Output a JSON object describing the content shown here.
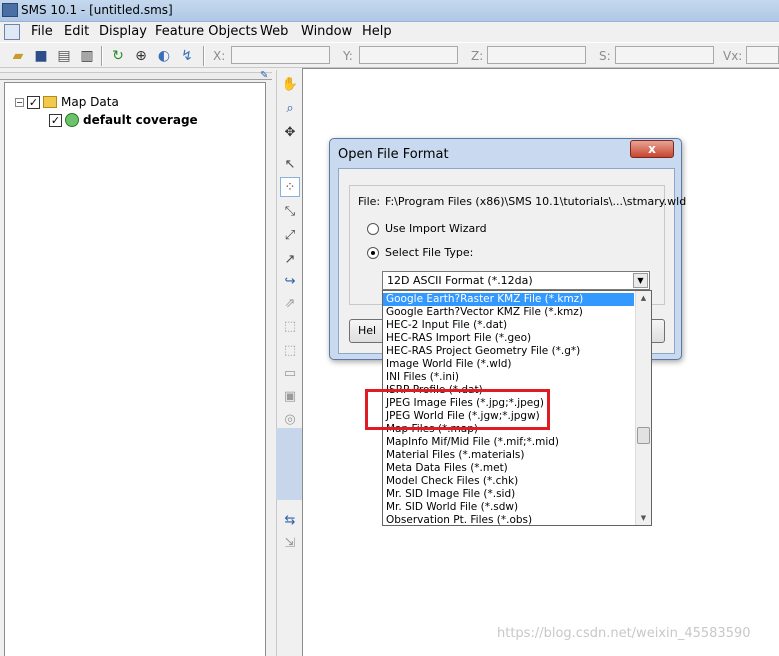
{
  "window": {
    "title": "SMS 10.1 - [untitled.sms]"
  },
  "menu": [
    "File",
    "Edit",
    "Display",
    "Feature Objects",
    "Web",
    "Window",
    "Help"
  ],
  "toolbar": {
    "icons": [
      "open-icon",
      "save-icon",
      "print-icon",
      "delete-icon",
      "refresh-icon",
      "zoom-icon",
      "mapper-icon",
      "gauge-icon"
    ],
    "coord_labels": [
      "X:",
      "Y:",
      "Z:",
      "S:",
      "Vx:"
    ]
  },
  "tree": {
    "root": {
      "label": "Map Data",
      "expander": "−",
      "check": "✓"
    },
    "child": {
      "label": "default coverage",
      "check": "✓"
    }
  },
  "dialog": {
    "title": "Open File Format",
    "close_label": "x",
    "file_label": "File:",
    "file_path": "F:\\Program Files (x86)\\SMS 10.1\\tutorials\\...\\stmary.wld",
    "radio_import": "Use Import Wizard",
    "radio_select": "Select File Type:",
    "selected_radio": "select",
    "help_label": "Hel"
  },
  "combo": {
    "value": "12D ASCII Format (*.12da)"
  },
  "dropdown": {
    "items": [
      "Google Earth?Raster KMZ File (*.kmz)",
      "Google Earth?Vector KMZ File (*.kmz)",
      "HEC-2 Input File (*.dat)",
      "HEC-RAS Import File (*.geo)",
      "HEC-RAS Project Geometry File (*.g*)",
      "Image World File (*.wld)",
      "INI Files (*.ini)",
      "ISRP Profile (*.dat)",
      "JPEG Image Files (*.jpg;*.jpeg)",
      "JPEG World File (*.jgw;*.jpgw)",
      "Map Files (*.map)",
      "MapInfo Mif/Mid File (*.mif;*.mid)",
      "Material Files (*.materials)",
      "Meta Data Files (*.met)",
      "Model Check Files (*.chk)",
      "Mr. SID Image File (*.sid)",
      "Mr. SID World File (*.sdw)",
      "Observation Pt. Files (*.obs)"
    ],
    "selected_index": 0,
    "highlight_color": "#e01b24",
    "selection_color": "#3399ff"
  },
  "watermark": "https://blog.csdn.net/weixin_45583590"
}
